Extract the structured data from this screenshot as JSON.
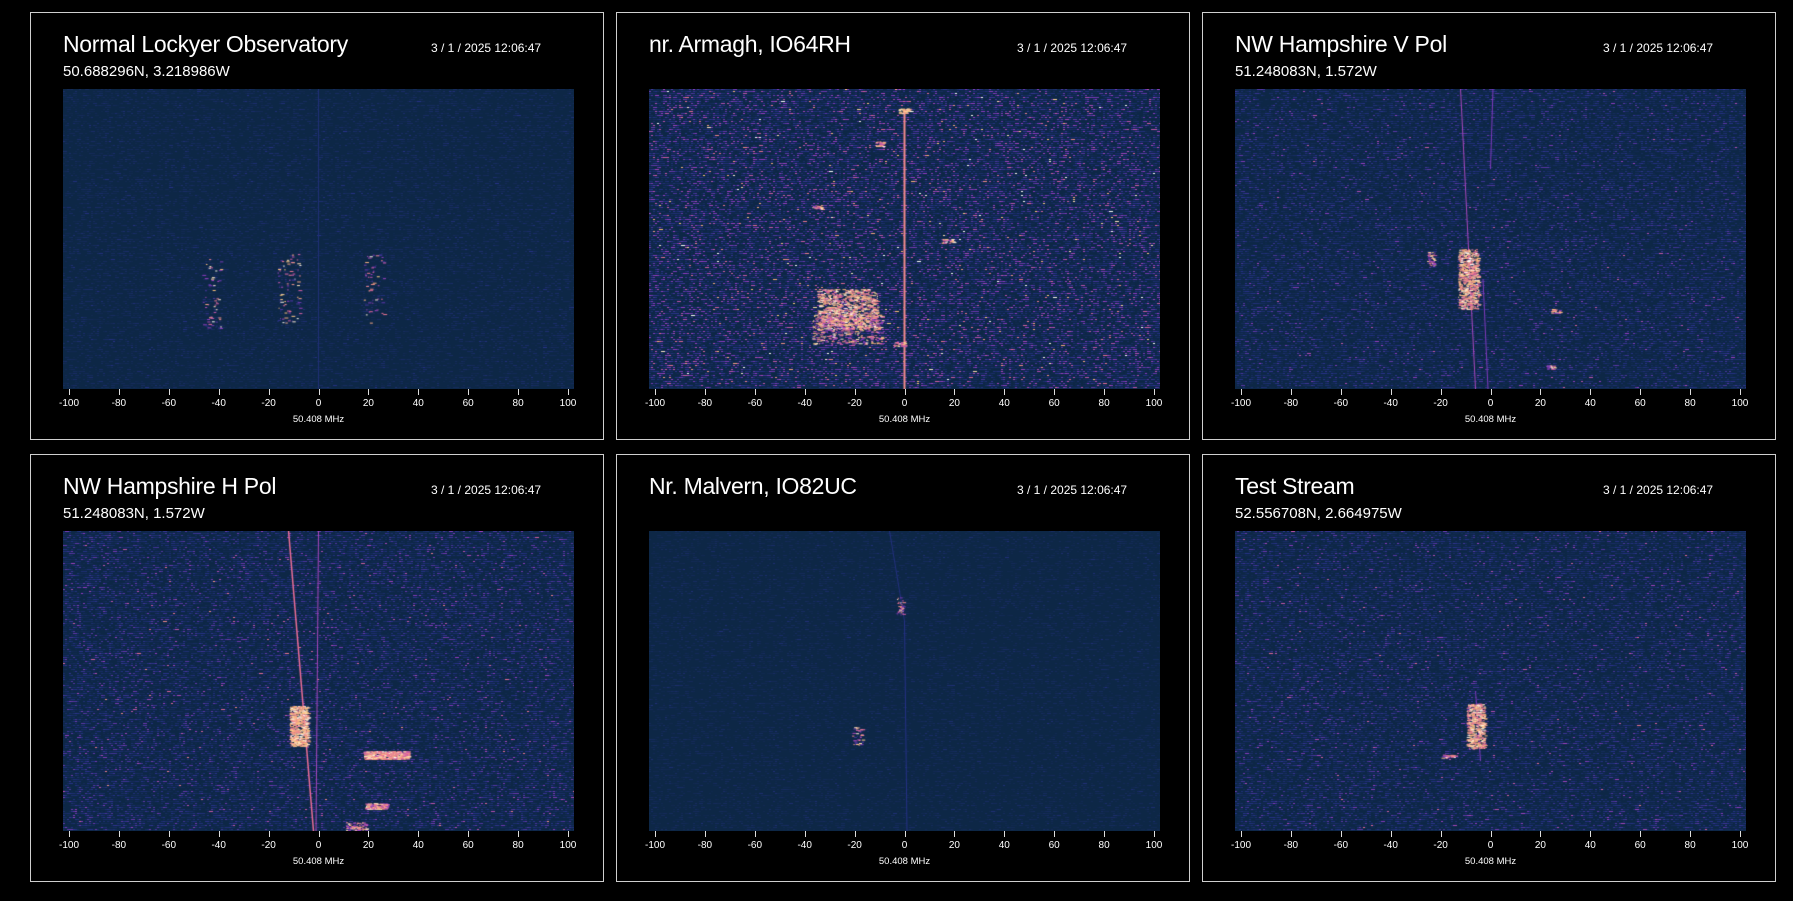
{
  "colors": {
    "background": "#000000",
    "border": "#cfcfcf",
    "text": "#ffffff"
  },
  "panels": [
    {
      "id": "lockyer",
      "title": "Normal Lockyer Observatory",
      "coords": "50.688296N, 3.218986W",
      "timestamp": "3 / 1 / 2025  12:06:47",
      "center_freq_label": "50.408 MHz",
      "axis_ticks": [
        "-100",
        "-80",
        "-60",
        "-40",
        "-20",
        "0",
        "20",
        "40",
        "60",
        "80",
        "100"
      ],
      "noise_level": 0.12
    },
    {
      "id": "armagh",
      "title": "nr. Armagh, IO64RH",
      "coords": "",
      "timestamp": "3 / 1 / 2025  12:06:47",
      "center_freq_label": "50.408 MHz",
      "axis_ticks": [
        "-100",
        "-80",
        "-60",
        "-40",
        "-20",
        "0",
        "20",
        "40",
        "60",
        "80",
        "100"
      ],
      "noise_level": 0.45
    },
    {
      "id": "nwh-v",
      "title": "NW Hampshire V Pol",
      "coords": "51.248083N, 1.572W",
      "timestamp": "3 / 1 / 2025  12:06:47",
      "center_freq_label": "50.408 MHz",
      "axis_ticks": [
        "-100",
        "-80",
        "-60",
        "-40",
        "-20",
        "0",
        "20",
        "40",
        "60",
        "80",
        "100"
      ],
      "noise_level": 0.28
    },
    {
      "id": "nwh-h",
      "title": "NW Hampshire H Pol",
      "coords": "51.248083N, 1.572W",
      "timestamp": "3 / 1 / 2025  12:06:47",
      "center_freq_label": "50.408 MHz",
      "axis_ticks": [
        "-100",
        "-80",
        "-60",
        "-40",
        "-20",
        "0",
        "20",
        "40",
        "60",
        "80",
        "100"
      ],
      "noise_level": 0.32
    },
    {
      "id": "malvern",
      "title": "Nr. Malvern, IO82UC",
      "coords": "",
      "timestamp": "3 / 1 / 2025  12:06:47",
      "center_freq_label": "50.408 MHz",
      "axis_ticks": [
        "-100",
        "-80",
        "-60",
        "-40",
        "-20",
        "0",
        "20",
        "40",
        "60",
        "80",
        "100"
      ],
      "noise_level": 0.1
    },
    {
      "id": "test",
      "title": "Test Stream",
      "coords": "52.556708N, 2.664975W",
      "timestamp": "3 / 1 / 2025  12:06:47",
      "center_freq_label": "50.408 MHz",
      "axis_ticks": [
        "-100",
        "-80",
        "-60",
        "-40",
        "-20",
        "0",
        "20",
        "40",
        "60",
        "80",
        "100"
      ],
      "noise_level": 0.3
    }
  ]
}
